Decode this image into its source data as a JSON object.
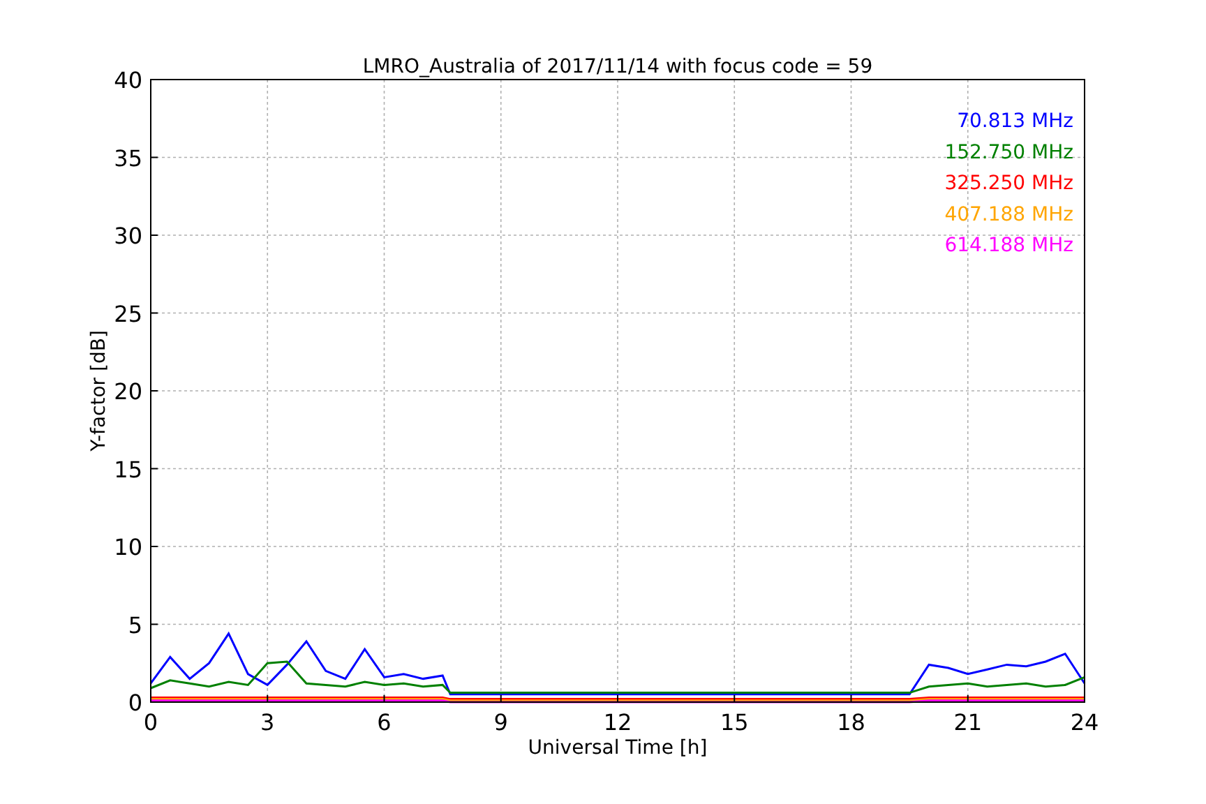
{
  "chart_data": {
    "type": "line",
    "title": "LMRO_Australia of 2017/11/14 with focus code = 59",
    "xlabel": "Universal Time [h]",
    "ylabel": "Y-factor [dB]",
    "x": [
      0,
      0.5,
      1,
      1.5,
      2,
      2.5,
      3,
      3.5,
      4,
      4.5,
      5,
      5.5,
      6,
      6.5,
      7,
      7.5,
      7.7,
      19.5,
      20,
      20.5,
      21,
      21.5,
      22,
      22.5,
      23,
      23.5,
      24
    ],
    "series": [
      {
        "name": "70.813 MHz",
        "color": "#0000ff",
        "values": [
          1.2,
          2.9,
          1.5,
          2.5,
          4.4,
          1.8,
          1.1,
          2.4,
          3.9,
          2.0,
          1.5,
          3.4,
          1.6,
          1.8,
          1.5,
          1.7,
          0.5,
          0.5,
          2.4,
          2.2,
          1.8,
          2.1,
          2.4,
          2.3,
          2.6,
          3.1,
          1.2
        ]
      },
      {
        "name": "152.750 MHz",
        "color": "#008000",
        "values": [
          0.9,
          1.4,
          1.2,
          1.0,
          1.3,
          1.1,
          2.5,
          2.6,
          1.2,
          1.1,
          1.0,
          1.3,
          1.1,
          1.2,
          1.0,
          1.1,
          0.6,
          0.6,
          1.0,
          1.1,
          1.2,
          1.0,
          1.1,
          1.2,
          1.0,
          1.1,
          1.6
        ]
      },
      {
        "name": "325.250 MHz",
        "color": "#ff0000",
        "values": [
          0.3,
          0.3,
          0.3,
          0.3,
          0.3,
          0.3,
          0.3,
          0.3,
          0.3,
          0.3,
          0.3,
          0.3,
          0.3,
          0.3,
          0.3,
          0.3,
          0.2,
          0.2,
          0.3,
          0.3,
          0.3,
          0.3,
          0.3,
          0.3,
          0.3,
          0.3,
          0.3
        ]
      },
      {
        "name": "407.188 MHz",
        "color": "#ffa500",
        "values": [
          0.2,
          0.2,
          0.2,
          0.2,
          0.2,
          0.2,
          0.2,
          0.2,
          0.2,
          0.2,
          0.2,
          0.2,
          0.2,
          0.2,
          0.2,
          0.2,
          0.1,
          0.1,
          0.2,
          0.2,
          0.2,
          0.2,
          0.2,
          0.2,
          0.2,
          0.2,
          0.2
        ]
      },
      {
        "name": "614.188 MHz",
        "color": "#ff00ff",
        "values": [
          0.1,
          0.1,
          0.1,
          0.1,
          0.1,
          0.1,
          0.1,
          0.1,
          0.1,
          0.1,
          0.1,
          0.1,
          0.1,
          0.1,
          0.1,
          0.1,
          0.0,
          0.0,
          0.1,
          0.1,
          0.1,
          0.1,
          0.1,
          0.1,
          0.1,
          0.1,
          0.1
        ]
      }
    ],
    "grid": true,
    "xlim": [
      0,
      24
    ],
    "ylim": [
      0,
      40
    ],
    "xticks": [
      0,
      3,
      6,
      9,
      12,
      15,
      18,
      21,
      24
    ],
    "yticks": [
      0,
      5,
      10,
      15,
      20,
      25,
      30,
      35,
      40
    ]
  }
}
